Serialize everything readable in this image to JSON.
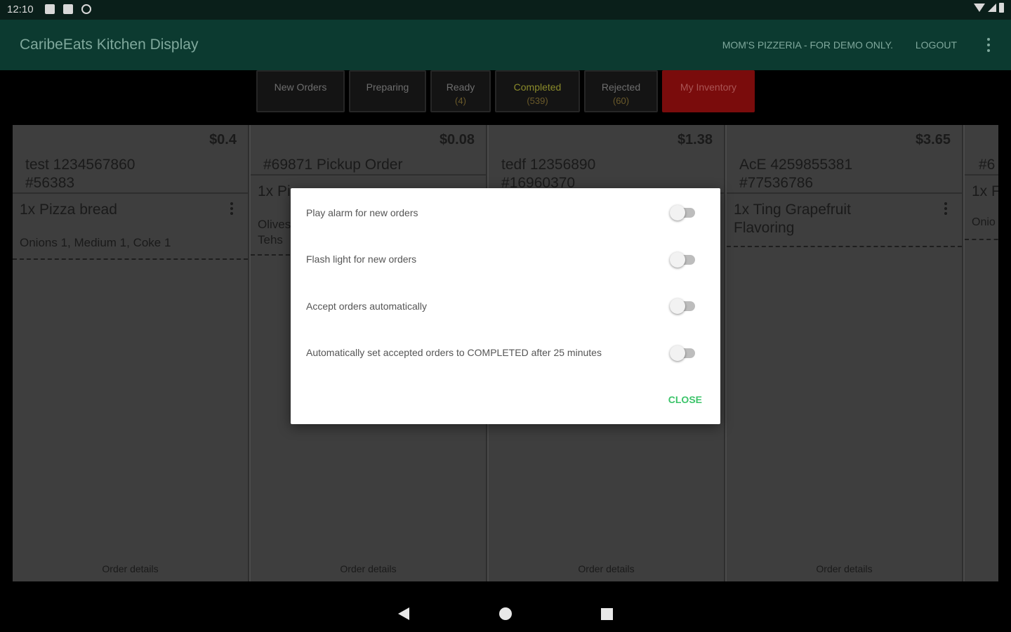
{
  "status_bar": {
    "time": "12:10"
  },
  "app_bar": {
    "title": "CaribeEats Kitchen Display",
    "store_label": "MOM'S PIZZERIA - FOR DEMO ONLY.",
    "logout_label": "LOGOUT"
  },
  "tabs": [
    {
      "label": "New Orders",
      "count": ""
    },
    {
      "label": "Preparing",
      "count": ""
    },
    {
      "label": "Ready",
      "count": "(4)"
    },
    {
      "label": "Completed",
      "count": "(539)"
    },
    {
      "label": "Rejected",
      "count": "(60)"
    },
    {
      "label": "My Inventory",
      "count": ""
    }
  ],
  "orders": [
    {
      "price": "$0.4",
      "name_line1": "test 1234567860",
      "name_line2": "#56383",
      "item": "1x Pizza bread",
      "item_line2": "",
      "mods": "Onions 1, Medium 1, Coke 1",
      "details": "Order details"
    },
    {
      "price": "$0.08",
      "name_line1": "#69871 Pickup Order",
      "name_line2": "",
      "item": "1x Pi",
      "item_line2": "",
      "mods": "Olives",
      "mods_line2": "Tehs",
      "details": "Order details"
    },
    {
      "price": "$1.38",
      "name_line1": "tedf 12356890",
      "name_line2": "#16960370",
      "item": "",
      "item_line2": "",
      "mods": "",
      "details": "Order details"
    },
    {
      "price": "$3.65",
      "name_line1": "AcE 4259855381",
      "name_line2": "#77536786",
      "item": "1x Ting Grapefruit",
      "item_line2": "Flavoring",
      "mods": "",
      "details": "Order details"
    },
    {
      "price": "",
      "name_line1": "#6",
      "name_line2": "",
      "item": "1x F",
      "item_line2": "",
      "mods": "Onio",
      "details": ""
    }
  ],
  "dialog": {
    "options": [
      {
        "label": "Play alarm for new orders",
        "enabled": false
      },
      {
        "label": "Flash light for new orders",
        "enabled": false
      },
      {
        "label": "Accept orders automatically",
        "enabled": false
      },
      {
        "label": "Automatically set accepted orders to COMPLETED after 25 minutes",
        "enabled": false
      }
    ],
    "close_label": "CLOSE"
  },
  "colors": {
    "app_bar": "#0c3a30",
    "inventory_tab": "#7a0c0c",
    "close_button": "#3cc46a"
  }
}
